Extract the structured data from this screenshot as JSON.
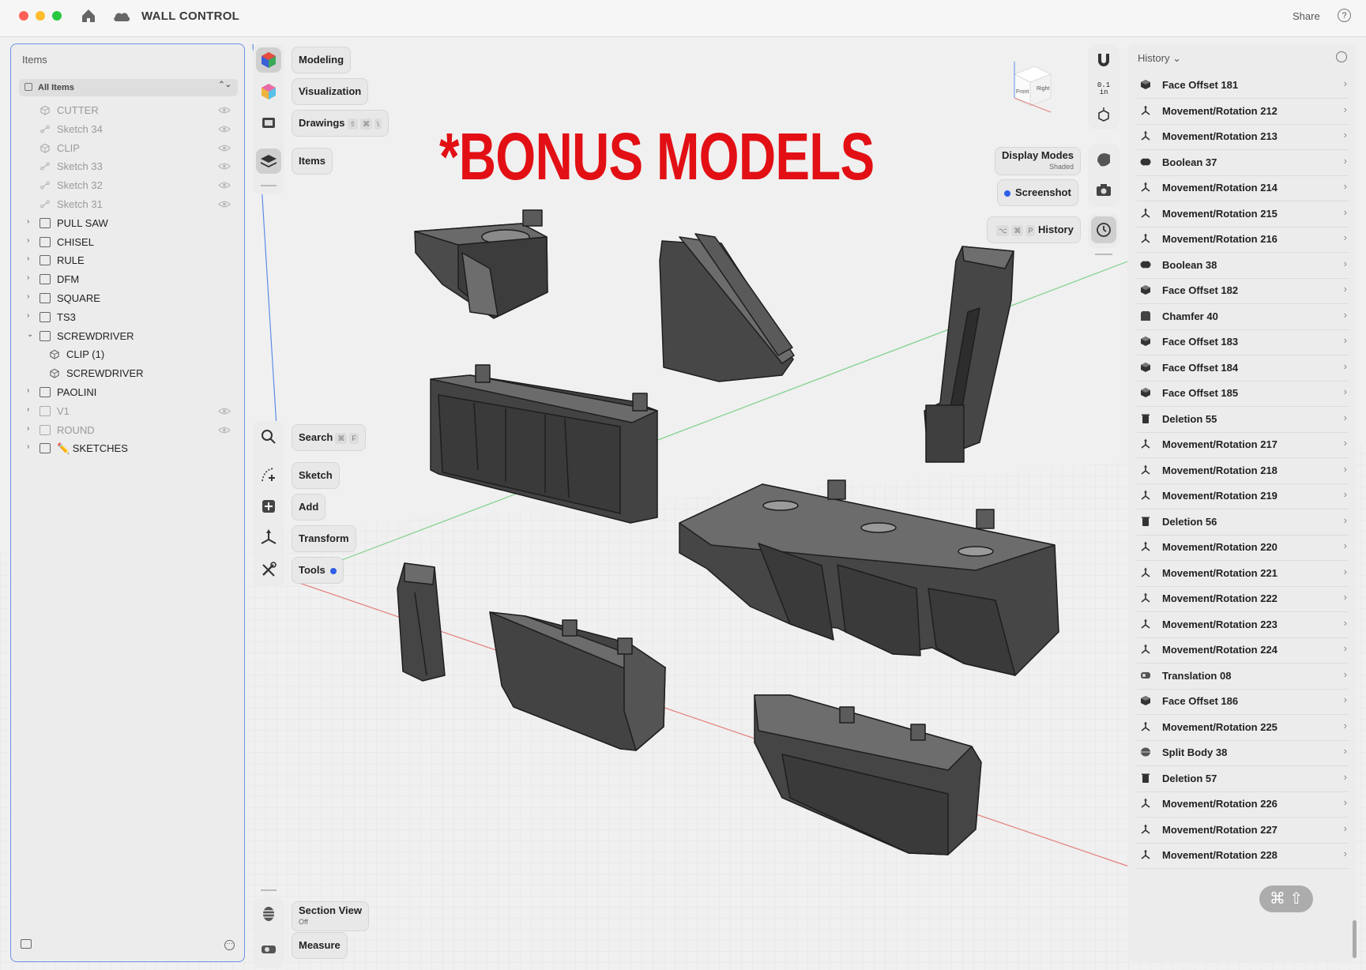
{
  "app": {
    "title": "WALL CONTROL",
    "share_label": "Share",
    "help_label": "?"
  },
  "overlay_text": "*BONUS MODELS",
  "items_panel": {
    "title": "Items",
    "filter_label": "All Items",
    "rows": [
      {
        "label": "CUTTER",
        "kind": "body",
        "dim": true,
        "indent": 1,
        "hidden": true
      },
      {
        "label": "Sketch 34",
        "kind": "sketch",
        "dim": true,
        "indent": 1,
        "hidden": true
      },
      {
        "label": "CLIP",
        "kind": "body",
        "dim": true,
        "indent": 1,
        "hidden": true
      },
      {
        "label": "Sketch 33",
        "kind": "sketch",
        "dim": true,
        "indent": 1,
        "hidden": true
      },
      {
        "label": "Sketch 32",
        "kind": "sketch",
        "dim": true,
        "indent": 1,
        "hidden": true
      },
      {
        "label": "Sketch 31",
        "kind": "sketch",
        "dim": true,
        "indent": 1,
        "hidden": true
      },
      {
        "label": "PULL SAW",
        "kind": "folder",
        "dim": false,
        "indent": 1,
        "expanded": false
      },
      {
        "label": "CHISEL",
        "kind": "folder",
        "dim": false,
        "indent": 1,
        "expanded": false
      },
      {
        "label": "RULE",
        "kind": "folder",
        "dim": false,
        "indent": 1,
        "expanded": false
      },
      {
        "label": "DFM",
        "kind": "folder",
        "dim": false,
        "indent": 1,
        "expanded": false
      },
      {
        "label": "SQUARE",
        "kind": "folder",
        "dim": false,
        "indent": 1,
        "expanded": false
      },
      {
        "label": "TS3",
        "kind": "folder",
        "dim": false,
        "indent": 1,
        "expanded": false
      },
      {
        "label": "SCREWDRIVER",
        "kind": "folder",
        "dim": false,
        "indent": 1,
        "expanded": true
      },
      {
        "label": "CLIP (1)",
        "kind": "body",
        "dim": false,
        "indent": 2
      },
      {
        "label": "SCREWDRIVER",
        "kind": "body",
        "dim": false,
        "indent": 2
      },
      {
        "label": "PAOLINI",
        "kind": "folder",
        "dim": false,
        "indent": 1,
        "expanded": false
      },
      {
        "label": "V1",
        "kind": "folder",
        "dim": true,
        "indent": 1,
        "expanded": false,
        "hidden": true
      },
      {
        "label": "ROUND",
        "kind": "folder",
        "dim": true,
        "indent": 1,
        "expanded": false,
        "hidden": true
      },
      {
        "label": "✏️ SKETCHES",
        "kind": "folder",
        "dim": false,
        "indent": 1,
        "expanded": false
      }
    ]
  },
  "toolbar": {
    "modeling": "Modeling",
    "visualization": "Visualization",
    "drawings": "Drawings",
    "drawings_keys": [
      "⇧",
      "⌘",
      "\\"
    ],
    "items": "Items",
    "search": "Search",
    "search_keys": [
      "⌘",
      "F"
    ],
    "sketch": "Sketch",
    "add": "Add",
    "transform": "Transform",
    "tools": "Tools",
    "section_view": "Section View",
    "section_view_state": "Off",
    "measure": "Measure"
  },
  "right_controls": {
    "units_label": "0.1\nin",
    "display_modes": "Display Modes",
    "display_modes_value": "Shaded",
    "screenshot": "Screenshot",
    "history": "History",
    "history_keys": [
      "⌥",
      "⌘",
      "P"
    ],
    "viewcube_front": "Front",
    "viewcube_right": "Right"
  },
  "history_panel": {
    "title": "History",
    "items": [
      {
        "label": "Face Offset 181",
        "icon": "face-offset"
      },
      {
        "label": "Movement/Rotation 212",
        "icon": "movement"
      },
      {
        "label": "Movement/Rotation 213",
        "icon": "movement"
      },
      {
        "label": "Boolean 37",
        "icon": "boolean"
      },
      {
        "label": "Movement/Rotation 214",
        "icon": "movement"
      },
      {
        "label": "Movement/Rotation 215",
        "icon": "movement"
      },
      {
        "label": "Movement/Rotation 216",
        "icon": "movement"
      },
      {
        "label": "Boolean 38",
        "icon": "boolean"
      },
      {
        "label": "Face Offset 182",
        "icon": "face-offset"
      },
      {
        "label": "Chamfer 40",
        "icon": "chamfer"
      },
      {
        "label": "Face Offset 183",
        "icon": "face-offset"
      },
      {
        "label": "Face Offset 184",
        "icon": "face-offset"
      },
      {
        "label": "Face Offset 185",
        "icon": "face-offset"
      },
      {
        "label": "Deletion 55",
        "icon": "deletion"
      },
      {
        "label": "Movement/Rotation 217",
        "icon": "movement"
      },
      {
        "label": "Movement/Rotation 218",
        "icon": "movement"
      },
      {
        "label": "Movement/Rotation 219",
        "icon": "movement"
      },
      {
        "label": "Deletion 56",
        "icon": "deletion"
      },
      {
        "label": "Movement/Rotation 220",
        "icon": "movement"
      },
      {
        "label": "Movement/Rotation 221",
        "icon": "movement"
      },
      {
        "label": "Movement/Rotation 222",
        "icon": "movement"
      },
      {
        "label": "Movement/Rotation 223",
        "icon": "movement"
      },
      {
        "label": "Movement/Rotation 224",
        "icon": "movement"
      },
      {
        "label": "Translation 08",
        "icon": "translation"
      },
      {
        "label": "Face Offset 186",
        "icon": "face-offset"
      },
      {
        "label": "Movement/Rotation 225",
        "icon": "movement"
      },
      {
        "label": "Split Body 38",
        "icon": "split"
      },
      {
        "label": "Deletion 57",
        "icon": "deletion"
      },
      {
        "label": "Movement/Rotation 226",
        "icon": "movement"
      },
      {
        "label": "Movement/Rotation 227",
        "icon": "movement"
      },
      {
        "label": "Movement/Rotation 228",
        "icon": "movement"
      }
    ]
  },
  "keyboard_overlay": "⌘ ⇧",
  "colors": {
    "accent": "#2f5fe8",
    "overlay_red": "#e20f14",
    "model_gray": "#4a4a4b"
  }
}
